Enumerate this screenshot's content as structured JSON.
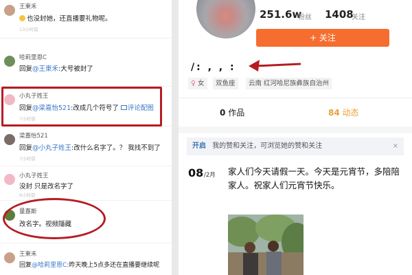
{
  "comments": [
    {
      "user": "王東禾",
      "text": "也没封她，还直播要礼物呢。",
      "time": "13小时前",
      "avatar_color": "#c9a08a"
    },
    {
      "user": "哈莉里恩C",
      "prefix": "回复",
      "mention": "@王東禾",
      "text": ":大号被封了",
      "time": "",
      "avatar_color": "#6d8f5a"
    },
    {
      "user": "小丸子姓王",
      "prefix": "回复",
      "mention": "@梁嘉怡521",
      "text": ":改成几个符号了",
      "extra": "评论配图",
      "time": "7小时前",
      "avatar_color": "#f1b9c6"
    },
    {
      "user": "梁嘉怡521",
      "prefix": "回复",
      "mention": "@小丸子姓王",
      "text": ":改什么名字了。？ 我找不到了",
      "time": "7小时前",
      "avatar_color": "#7a6c66"
    },
    {
      "user": "小丸子姓王",
      "text": "没封 只是改名字了",
      "time": "6小时前",
      "avatar_color": "#f1b9c6"
    },
    {
      "user": "量嘉斯",
      "text": "改名字。视频隱藏",
      "time": "",
      "avatar_color": "#5e7d3c"
    },
    {
      "user": "王東禾",
      "prefix": "回复",
      "mention": "@哈莉里恩C",
      "text": ":昨天晚上5点多还在直播要继续呢",
      "time": "",
      "avatar_color": "#c9a08a"
    }
  ],
  "profile": {
    "fans_count": "251.6w",
    "fans_label": "粉丝",
    "following_count": "1408",
    "following_label": "关注",
    "follow_button": "+ 关注",
    "nickname": "/:  ,  ,  :",
    "gender_tag": "女",
    "zodiac_tag": "双鱼座",
    "location_tag": "云南 红河哈尼族彝族自治州",
    "works_num": "0",
    "works_label": "作品",
    "updates_num": "84",
    "updates_label": "动态",
    "open_link": "开启",
    "open_text": "我的赞和关注，可浏览她的赞和关注",
    "open_close": "×",
    "post_day": "08",
    "post_month": "/2月",
    "post_text": "家人们今天请假一天。今天是元宵节，多陪陪家人。祝家人们元宵节快乐。"
  },
  "colors": {
    "accent_orange": "#f56e2f",
    "highlight_red": "#b51c22",
    "mention_blue": "#3a77c9"
  },
  "icons": {
    "female": "female-icon",
    "location": "location-pin-icon",
    "image": "image-icon"
  }
}
